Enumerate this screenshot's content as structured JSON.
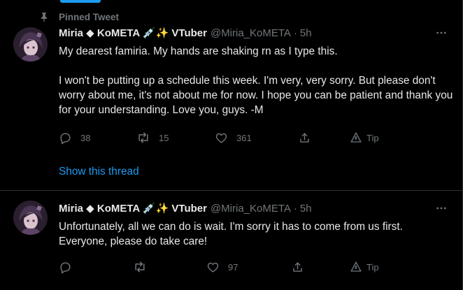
{
  "pinned_label": "Pinned Tweet",
  "colors": {
    "background": "#000000",
    "text_primary": "#e7e9ea",
    "text_secondary": "#71767b",
    "accent": "#1d9bf0",
    "divider": "#2f3336"
  },
  "tweets": [
    {
      "display_name": "Miria ◆ KoMETA 💉✨ VTuber",
      "handle": "@Miria_KoMETA",
      "separator": "·",
      "time": "5h",
      "text": [
        "My dearest famiria. My hands are shaking rn as I type this.",
        "I won't be putting up a schedule this week. I'm very, very sorry. But please don't worry about me, it's not about me for now. I hope you can be patient and thank you for your understanding. Love you, guys. -M"
      ],
      "actions": {
        "replies": "38",
        "retweets": "15",
        "likes": "361",
        "tip_label": "Tip"
      },
      "show_thread": "Show this thread"
    },
    {
      "display_name": "Miria ◆ KoMETA 💉✨ VTuber",
      "handle": "@Miria_KoMETA",
      "separator": "·",
      "time": "5h",
      "text": [
        "Unfortunately, all we can do is wait. I'm sorry it has to come from us first. Everyone, please do take care!"
      ],
      "actions": {
        "replies": "",
        "retweets": "",
        "likes": "97",
        "tip_label": "Tip"
      }
    }
  ],
  "icons": {
    "pin": "pin-icon",
    "more": "more-icon",
    "reply": "reply-icon",
    "retweet": "retweet-icon",
    "like": "heart-icon",
    "share": "share-icon",
    "tip": "tip-icon"
  }
}
